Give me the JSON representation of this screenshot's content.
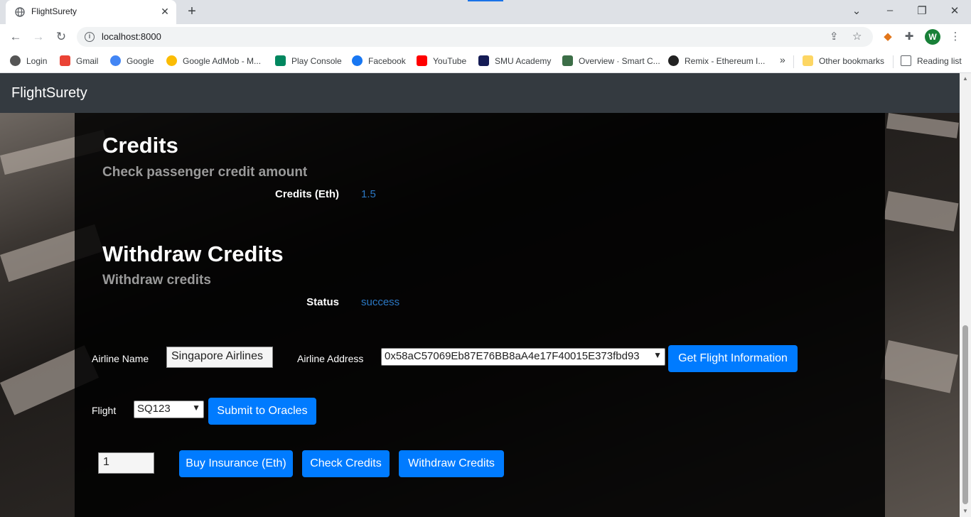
{
  "browser": {
    "tab_title": "FlightSurety",
    "url": "localhost:8000",
    "avatar_letter": "W",
    "bookmarks": [
      {
        "label": "Login",
        "color": "#555555"
      },
      {
        "label": "Gmail",
        "color": "#ea4335"
      },
      {
        "label": "Google",
        "color": "#4285f4"
      },
      {
        "label": "Google AdMob - M...",
        "color": "#fbbc04"
      },
      {
        "label": "Play Console",
        "color": "#01875f"
      },
      {
        "label": "Facebook",
        "color": "#1877f2"
      },
      {
        "label": "YouTube",
        "color": "#ff0000"
      },
      {
        "label": "SMU Academy",
        "color": "#151c55"
      },
      {
        "label": "Overview · Smart C...",
        "color": "#3c6e47"
      },
      {
        "label": "Remix - Ethereum I...",
        "color": "#222222"
      }
    ],
    "overflow": "»",
    "other_bookmarks": "Other bookmarks",
    "reading_list": "Reading list"
  },
  "app": {
    "brand": "FlightSurety",
    "credits": {
      "heading": "Credits",
      "subheading": "Check passenger credit amount",
      "label": "Credits (Eth)",
      "value": "1.5"
    },
    "withdraw": {
      "heading": "Withdraw Credits",
      "subheading": "Withdraw credits",
      "label": "Status",
      "value": "success"
    },
    "form": {
      "airline_name_label": "Airline Name",
      "airline_name_value": "Singapore Airlines",
      "airline_address_label": "Airline Address",
      "airline_address_value": "0x58aC57069Eb87E76BB8aA4e17F40015E373fbd93",
      "get_flight_button": "Get Flight Information",
      "flight_label": "Flight",
      "flight_value": "SQ123",
      "submit_oracles_button": "Submit to Oracles",
      "amount_value": "1",
      "buy_insurance_button": "Buy Insurance (Eth)",
      "check_credits_button": "Check Credits",
      "withdraw_credits_button": "Withdraw Credits"
    }
  }
}
